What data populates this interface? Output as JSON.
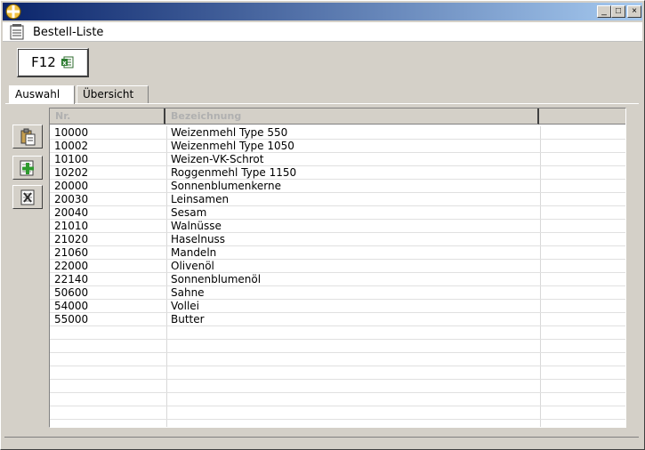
{
  "window": {
    "controls": {
      "minimize": "_",
      "maximize": "□",
      "close": "×"
    }
  },
  "document": {
    "title": "Bestell-Liste"
  },
  "toolbar": {
    "f12_label": "F12"
  },
  "tabs": [
    {
      "label": "Auswahl",
      "active": true
    },
    {
      "label": "Übersicht",
      "active": false
    }
  ],
  "side_tools": [
    {
      "icon": "paste-icon"
    },
    {
      "icon": "add-icon"
    },
    {
      "icon": "delete-icon"
    }
  ],
  "table": {
    "columns": [
      "Nr.",
      "Bezeichnung"
    ],
    "rows": [
      [
        "10000",
        "Weizenmehl Type 550"
      ],
      [
        "10002",
        "Weizenmehl Type 1050"
      ],
      [
        "10100",
        "Weizen-VK-Schrot"
      ],
      [
        "10202",
        "Roggenmehl Type 1150"
      ],
      [
        "20000",
        "Sonnenblumenkerne"
      ],
      [
        "20030",
        "Leinsamen"
      ],
      [
        "20040",
        "Sesam"
      ],
      [
        "21010",
        "Walnüsse"
      ],
      [
        "21020",
        "Haselnuss"
      ],
      [
        "21060",
        "Mandeln"
      ],
      [
        "22000",
        "Olivenöl"
      ],
      [
        "22140",
        "Sonnenblumenöl"
      ],
      [
        "50600",
        "Sahne"
      ],
      [
        "54000",
        "Vollei"
      ],
      [
        "55000",
        "Butter"
      ]
    ],
    "empty_rows": 8
  }
}
